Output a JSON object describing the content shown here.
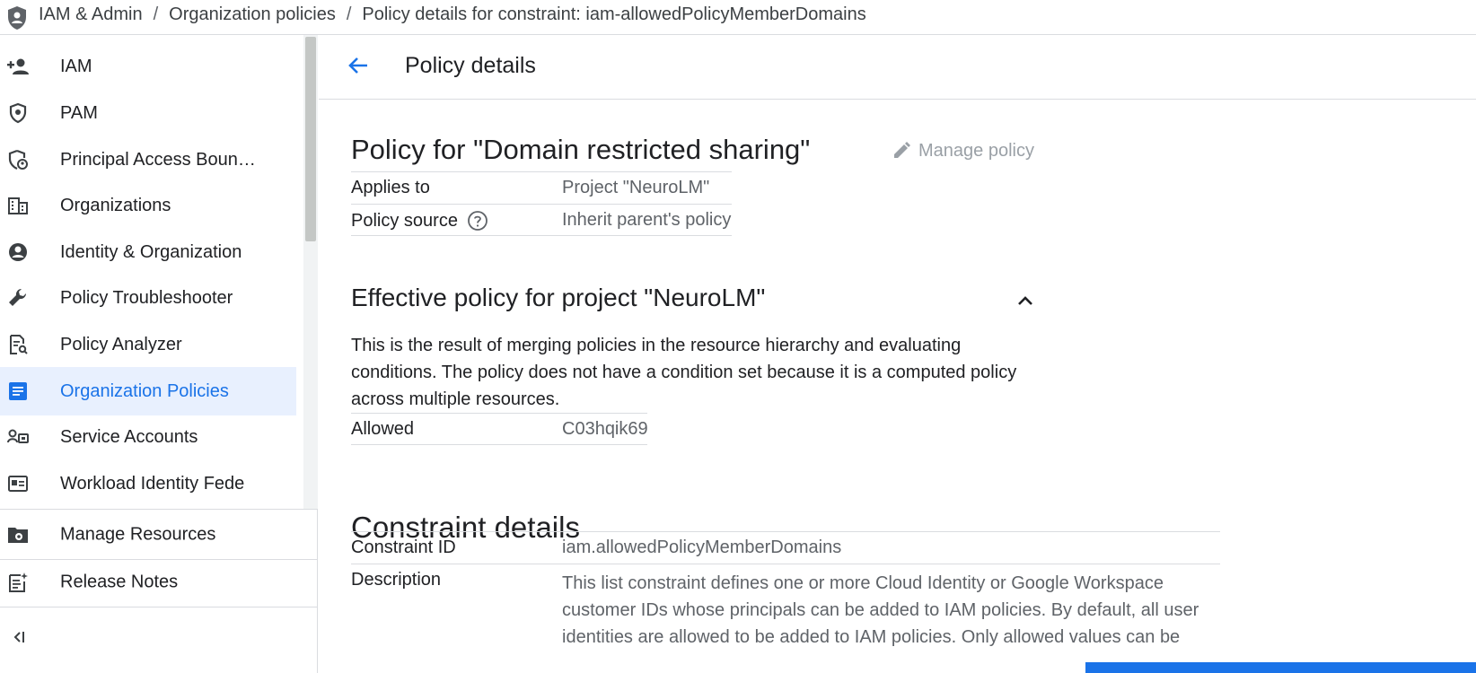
{
  "breadcrumb": {
    "items": [
      "IAM & Admin",
      "Organization policies",
      "Policy details for constraint: iam-allowedPolicyMemberDomains"
    ],
    "separator": "/"
  },
  "sidebar": {
    "items": [
      {
        "label": "IAM",
        "icon": "person-add-icon"
      },
      {
        "label": "PAM",
        "icon": "shield-badge-icon"
      },
      {
        "label": "Principal Access Boun…",
        "icon": "shield-person-icon"
      },
      {
        "label": "Organizations",
        "icon": "building-icon"
      },
      {
        "label": "Identity & Organization",
        "icon": "account-circle-icon"
      },
      {
        "label": "Policy Troubleshooter",
        "icon": "wrench-icon"
      },
      {
        "label": "Policy Analyzer",
        "icon": "document-search-icon"
      },
      {
        "label": "Organization Policies",
        "icon": "list-document-icon",
        "active": true
      },
      {
        "label": "Service Accounts",
        "icon": "service-account-icon"
      },
      {
        "label": "Workload Identity Fede",
        "icon": "id-card-icon"
      }
    ],
    "bottom_items": [
      {
        "label": "Manage Resources",
        "icon": "folder-gear-icon"
      },
      {
        "label": "Release Notes",
        "icon": "notes-icon"
      }
    ],
    "collapse_icon": "collapse-left-icon"
  },
  "main": {
    "title": "Policy details",
    "policy_heading": "Policy for \"Domain restricted sharing\"",
    "manage_policy_label": "Manage policy",
    "policy_table": [
      {
        "key": "Applies to",
        "value": "Project \"NeuroLM\""
      },
      {
        "key": "Policy source",
        "value": "Inherit parent's policy"
      }
    ],
    "effective_heading": "Effective policy for project \"NeuroLM\"",
    "effective_description": "This is the result of merging policies in the resource hierarchy and evaluating conditions. The policy does not have a condition set because it is a computed policy across multiple resources.",
    "effective_table": [
      {
        "key": "Allowed",
        "value": "C03hqik69"
      }
    ],
    "constraint_heading": "Constraint details",
    "constraint_table": [
      {
        "key": "Constraint ID",
        "value": "iam.allowedPolicyMemberDomains"
      },
      {
        "key": "Description",
        "value": "This list constraint defines one or more Cloud Identity or Google Workspace customer IDs whose principals can be added to IAM policies. By default, all user identities are allowed to be added to IAM policies. Only allowed values can be"
      }
    ]
  },
  "colors": {
    "accent": "#1a73e8",
    "active_bg": "#e8f0fe",
    "border": "#dadce0",
    "muted_text": "#5f6368"
  }
}
